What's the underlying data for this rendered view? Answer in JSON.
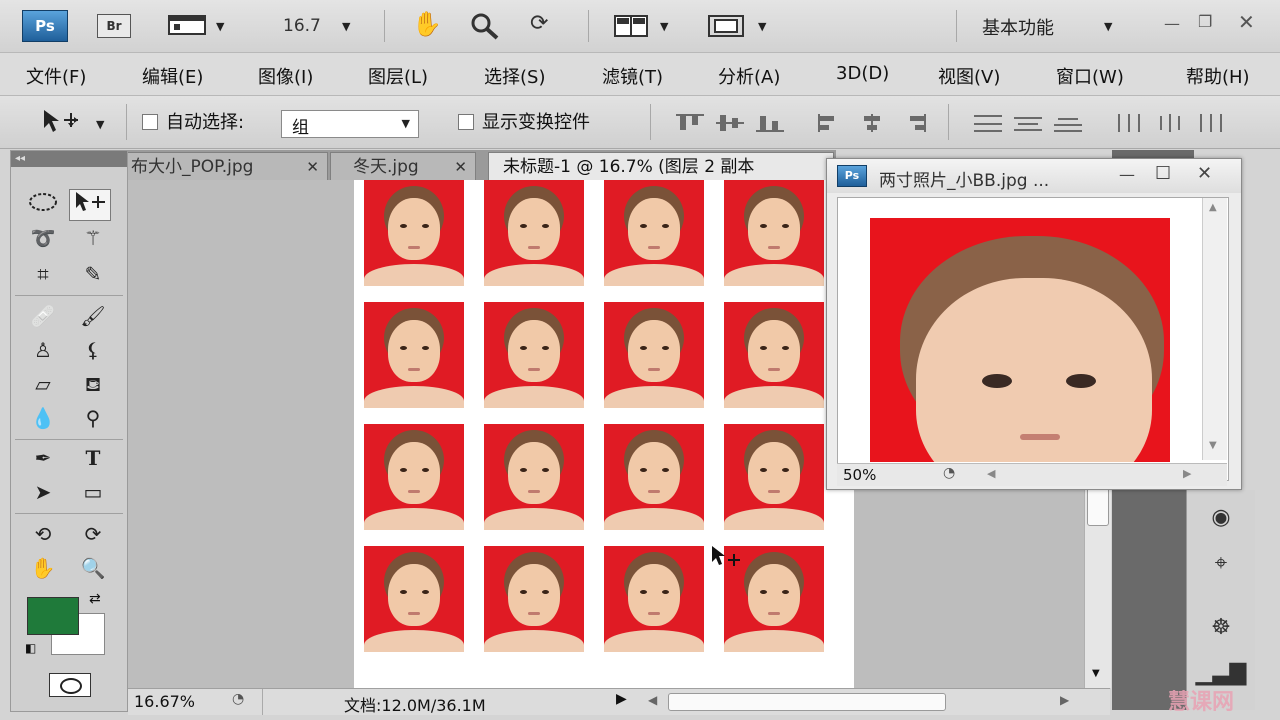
{
  "app": {
    "logo": "Ps",
    "bridge": "Br",
    "zoom": "16.7",
    "workspace": "基本功能"
  },
  "menu": [
    "文件(F)",
    "编辑(E)",
    "图像(I)",
    "图层(L)",
    "选择(S)",
    "滤镜(T)",
    "分析(A)",
    "3D(D)",
    "视图(V)",
    "窗口(W)",
    "帮助(H)"
  ],
  "options": {
    "auto_select_label": "自动选择:",
    "auto_select_value": "组",
    "show_transform_label": "显示变换控件"
  },
  "tabs": [
    {
      "label": "布大小_POP.jpg"
    },
    {
      "label": "冬天.jpg"
    },
    {
      "label": "未标题-1 @ 16.7% (图层 2 副本"
    }
  ],
  "statusbar": {
    "zoom": "16.67%",
    "doc_info": "文档:12.0M/36.1M"
  },
  "float_window": {
    "logo": "Ps",
    "title": "两寸照片_小BB.jpg ...",
    "zoom": "50%"
  },
  "colors": {
    "foreground": "#1f7a3a",
    "background": "#ffffff",
    "photo_bg": "#e01b24"
  },
  "watermark": "慧课网"
}
